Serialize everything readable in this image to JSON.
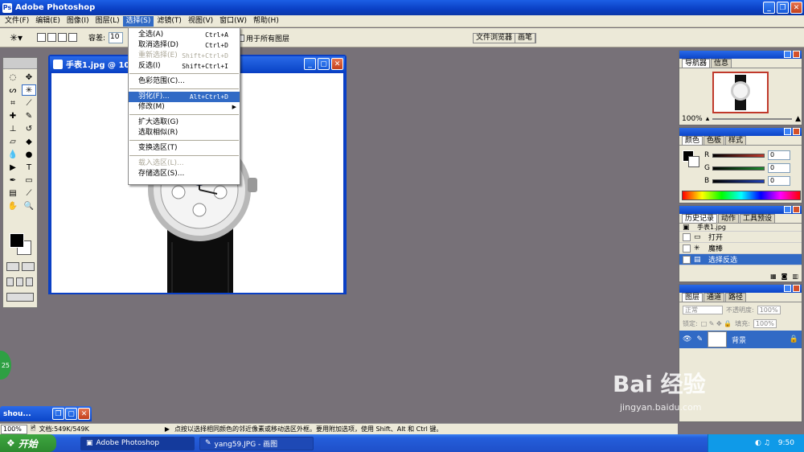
{
  "app": {
    "title": "Adobe Photoshop"
  },
  "menubar": {
    "items": [
      "文件(F)",
      "编辑(E)",
      "图像(I)",
      "图层(L)",
      "选择(S)",
      "滤镜(T)",
      "视图(V)",
      "窗口(W)",
      "帮助(H)"
    ],
    "active_index": 4
  },
  "options": {
    "tolerance_label": "容差:",
    "tolerance_value": "10",
    "all_layers_label": "用于所有图层",
    "palette_well": [
      "文件浏览器",
      "画笔"
    ]
  },
  "document": {
    "title": "手表1.jpg @ 10"
  },
  "select_menu": {
    "items": [
      {
        "label": "全选(A)",
        "shortcut": "Ctrl+A",
        "state": "normal"
      },
      {
        "label": "取消选择(D)",
        "shortcut": "Ctrl+D",
        "state": "normal"
      },
      {
        "label": "重新选择(E)",
        "shortcut": "Shift+Ctrl+D",
        "state": "disabled"
      },
      {
        "label": "反选(I)",
        "shortcut": "Shift+Ctrl+I",
        "state": "normal"
      },
      {
        "sep": true
      },
      {
        "label": "色彩范围(C)...",
        "shortcut": "",
        "state": "normal"
      },
      {
        "sep": true
      },
      {
        "label": "羽化(F)...",
        "shortcut": "Alt+Ctrl+D",
        "state": "highlighted"
      },
      {
        "label": "修改(M)",
        "shortcut": "",
        "state": "submenu"
      },
      {
        "sep": true
      },
      {
        "label": "扩大选取(G)",
        "shortcut": "",
        "state": "normal"
      },
      {
        "label": "选取相似(R)",
        "shortcut": "",
        "state": "normal"
      },
      {
        "sep": true
      },
      {
        "label": "变换选区(T)",
        "shortcut": "",
        "state": "normal"
      },
      {
        "sep": true
      },
      {
        "label": "载入选区(L)...",
        "shortcut": "",
        "state": "disabled"
      },
      {
        "label": "存储选区(S)...",
        "shortcut": "",
        "state": "normal"
      }
    ]
  },
  "navigator": {
    "tabs": [
      "导航器",
      "信息"
    ],
    "zoom": "100%"
  },
  "color_panel": {
    "tabs": [
      "颜色",
      "色板",
      "样式"
    ],
    "channels": [
      {
        "label": "R",
        "value": "0",
        "color": "#c0392b"
      },
      {
        "label": "G",
        "value": "0",
        "color": "#1e8c2e"
      },
      {
        "label": "B",
        "value": "0",
        "color": "#1f3fb5"
      }
    ]
  },
  "history": {
    "tabs": [
      "历史记录",
      "动作",
      "工具预设"
    ],
    "snapshot": "手表1.jpg",
    "items": [
      {
        "label": "打开",
        "selected": false
      },
      {
        "label": "魔棒",
        "selected": false
      },
      {
        "label": "选择反选",
        "selected": true
      }
    ]
  },
  "layers": {
    "tabs": [
      "图层",
      "通道",
      "路径"
    ],
    "blend_mode": "正常",
    "opacity_label": "不透明度:",
    "opacity_value": "100%",
    "lock_label": "锁定:",
    "fill_label": "填充:",
    "fill_value": "100%",
    "layer_name": "背景"
  },
  "status": {
    "zoom": "100%",
    "doc_info": "文档:549K/549K",
    "hint": "点按以选择相同颜色的邻近像素或移动选区外框。要用附加选项，使用 Shift、Alt 和 Ctrl 键。"
  },
  "minimized": {
    "title": "shou..."
  },
  "taskbar": {
    "start": "开始",
    "items": [
      "Adobe Photoshop",
      "yang59.JPG - 画图"
    ],
    "clock": "9:50"
  },
  "watermark": {
    "brand": "Bai 经验",
    "url": "jingyan.baidu.com"
  },
  "side_badge": "25",
  "colors": {
    "xp_blue": "#0a3fc4",
    "highlight": "#316ac5",
    "workspace": "#777178"
  }
}
